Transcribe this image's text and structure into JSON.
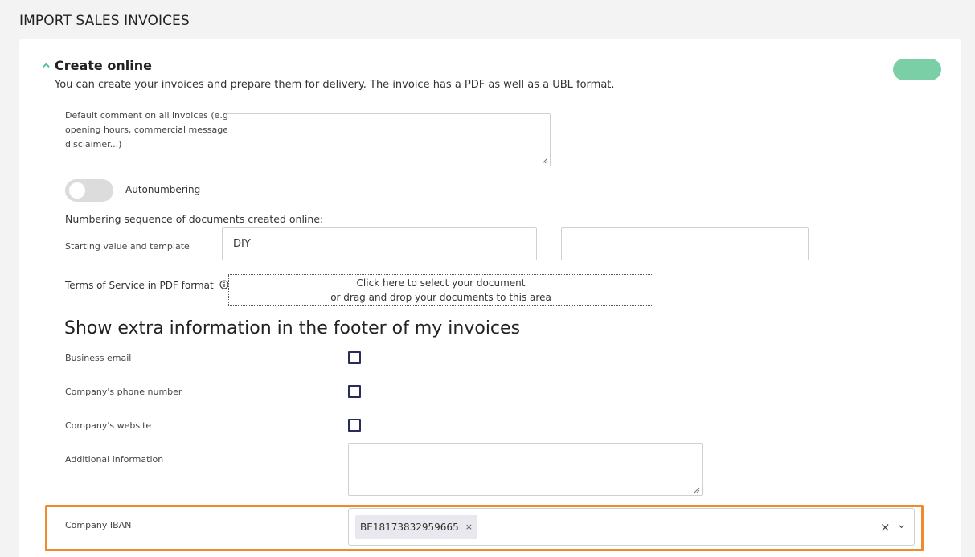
{
  "page": {
    "title": "IMPORT SALES INVOICES"
  },
  "section": {
    "icon": "chevron-up-icon",
    "title": "Create online",
    "description": "You can create your invoices and prepare them for delivery. The invoice has a PDF as well as a UBL format.",
    "toggle_color": "#7acfa6"
  },
  "default_comment": {
    "label_line1": "Default comment on all invoices (e.g.",
    "label_line2": "opening hours, commercial message,",
    "label_line3": "disclaimer...)",
    "value": ""
  },
  "autonumbering": {
    "label": "Autonumbering",
    "enabled": false
  },
  "numbering": {
    "heading": "Numbering sequence of documents created online:",
    "starting_label": "Starting value and template",
    "starting_value": "DIY-",
    "template_value": ""
  },
  "terms": {
    "label": "Terms of Service in PDF format",
    "icon": "info-icon",
    "dropzone_line1": "Click here to select your document",
    "dropzone_line2": "or drag and drop your documents to this area"
  },
  "footer": {
    "heading": "Show extra information in the footer of my invoices",
    "business_email_label": "Business email",
    "phone_label": "Company's phone number",
    "website_label": "Company's website",
    "additional_label": "Additional information",
    "additional_value": "",
    "iban_label": "Company IBAN",
    "iban_chip": "BE18173832959665",
    "chip_remove": "×",
    "clear_all": "×",
    "highlight_color": "#f08a2c"
  }
}
